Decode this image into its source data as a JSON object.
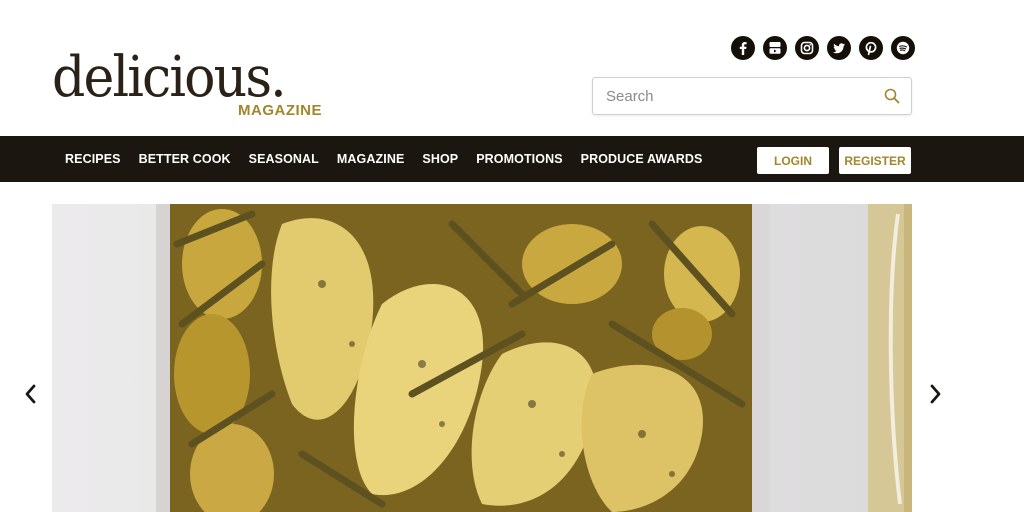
{
  "brand": {
    "name": "delicious.",
    "sub": "MAGAZINE",
    "color": "#a3862b"
  },
  "social": [
    {
      "icon": "facebook-icon"
    },
    {
      "icon": "youtube-icon"
    },
    {
      "icon": "instagram-icon"
    },
    {
      "icon": "twitter-icon"
    },
    {
      "icon": "pinterest-icon"
    },
    {
      "icon": "spotify-icon"
    }
  ],
  "search": {
    "placeholder": "Search",
    "value": "",
    "icon": "search-icon"
  },
  "nav": {
    "items": [
      {
        "label": "RECIPES"
      },
      {
        "label": "BETTER COOK"
      },
      {
        "label": "SEASONAL"
      },
      {
        "label": "MAGAZINE"
      },
      {
        "label": "SHOP"
      },
      {
        "label": "PROMOTIONS"
      },
      {
        "label": "PRODUCE AWARDS"
      }
    ],
    "login_label": "LOGIN",
    "register_label": "REGISTER",
    "background": "#1b160f"
  },
  "carousel": {
    "prev_icon": "chevron-left-icon",
    "next_icon": "chevron-right-icon",
    "slide_image": "roasted-fish-with-potatoes-and-asparagus"
  }
}
